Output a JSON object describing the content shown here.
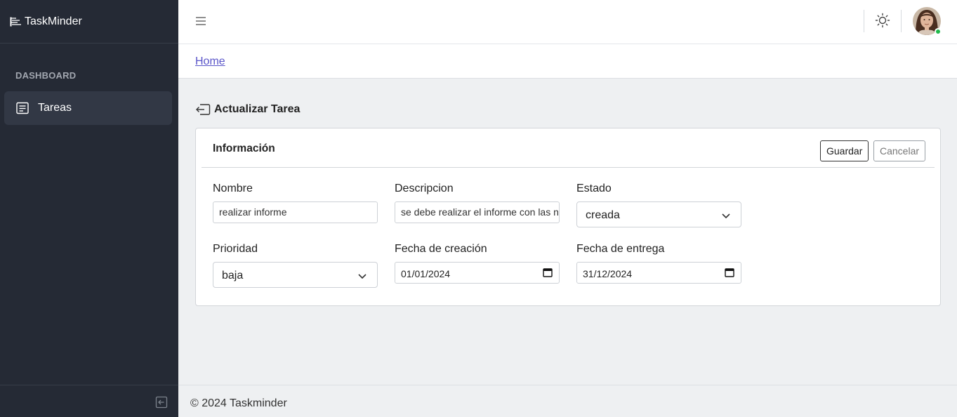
{
  "app": {
    "name": "TaskMinder"
  },
  "sidebar": {
    "section_title": "DASHBOARD",
    "items": [
      {
        "label": "Tareas",
        "icon": "document-list-icon",
        "active": true
      }
    ]
  },
  "breadcrumb": {
    "home": "Home"
  },
  "page": {
    "title": "Actualizar Tarea"
  },
  "card": {
    "title": "Información",
    "save_label": "Guardar",
    "cancel_label": "Cancelar"
  },
  "form": {
    "nombre": {
      "label": "Nombre",
      "value": "realizar informe"
    },
    "descripcion": {
      "label": "Descripcion",
      "value": "se debe realizar el informe con las n"
    },
    "estado": {
      "label": "Estado",
      "value": "creada"
    },
    "prioridad": {
      "label": "Prioridad",
      "value": "baja"
    },
    "fecha_creacion": {
      "label": "Fecha de creación",
      "value": "01/01/2024"
    },
    "fecha_entrega": {
      "label": "Fecha de entrega",
      "value": "31/12/2024"
    }
  },
  "footer": {
    "text": "© 2024 Taskminder"
  },
  "colors": {
    "sidebar_bg": "#252a35",
    "link": "#5a55c9",
    "status_online": "#20b94b"
  }
}
